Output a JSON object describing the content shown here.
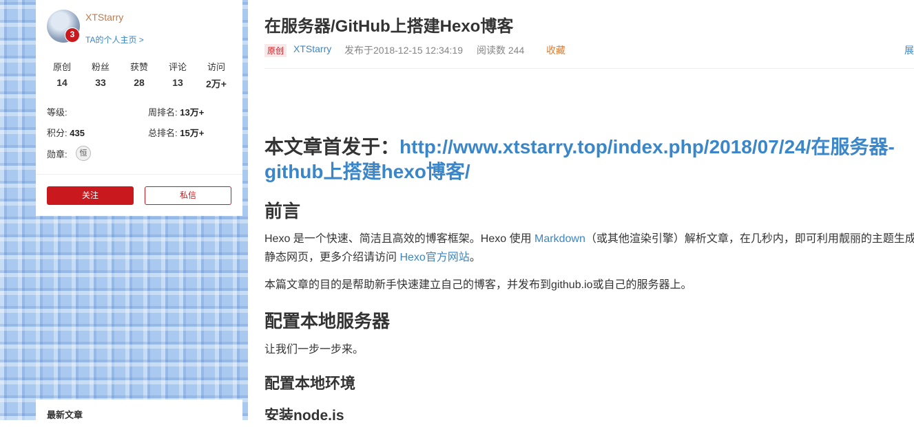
{
  "sidebar": {
    "username": "XTStarry",
    "home_link": "TA的个人主页 >",
    "level_badge": "3",
    "stats": [
      {
        "label": "原创",
        "value": "14"
      },
      {
        "label": "粉丝",
        "value": "33"
      },
      {
        "label": "获赞",
        "value": "28"
      },
      {
        "label": "评论",
        "value": "13"
      },
      {
        "label": "访问",
        "value": "2万+"
      }
    ],
    "level_label": "等级:",
    "week_rank_label": "周排名:",
    "week_rank_value": "13万+",
    "points_label": "积分:",
    "points_value": "435",
    "total_rank_label": "总排名:",
    "total_rank_value": "15万+",
    "medal_label": "勋章:",
    "medal_glyph": "恒",
    "follow_label": "关注",
    "message_label": "私信",
    "latest_title": "最新文章"
  },
  "article": {
    "title": "在服务器/GitHub上搭建Hexo博客",
    "tag": "原创",
    "author": "XTStarry",
    "date": "发布于2018-12-15 12:34:19",
    "reads": "阅读数 244",
    "favorite": "收藏",
    "expand": "展",
    "first_published_prefix": "本文章首发于：",
    "first_published_url": "http://www.xtstarry.top/index.php/2018/07/24/在服务器-github上搭建hexo博客/",
    "h_preface": "前言",
    "p1_a": "Hexo 是一个快速、简洁且高效的博客框架。Hexo 使用 ",
    "p1_link1": "Markdown",
    "p1_b": "（或其他渲染引擎）解析文章，在几秒内，即可利用靓丽的主题生成静态网页，更多介绍请访问 ",
    "p1_link2": "Hexo官方网站",
    "p1_c": "。",
    "p2": "本篇文章的目的是帮助新手快速建立自己的博客，并发布到github.io或自己的服务器上。",
    "h_local_server": "配置本地服务器",
    "p3": "让我们一步一步来。",
    "h_local_env": "配置本地环境",
    "h_install_node": "安装node.js"
  }
}
